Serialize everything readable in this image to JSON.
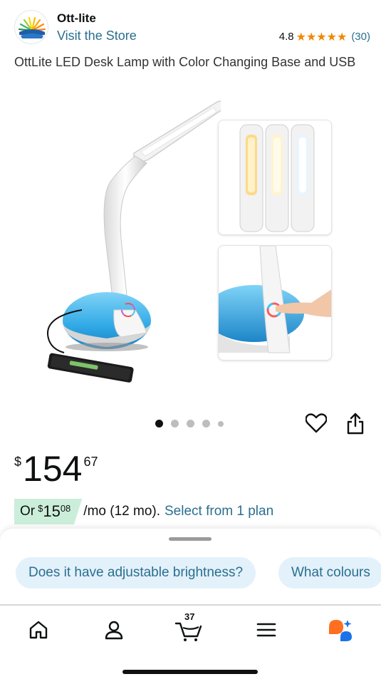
{
  "brand": {
    "name": "Ott-lite",
    "visit_store": "Visit the Store",
    "rating": "4.8",
    "stars": "★★★★★",
    "rating_count": "(30)"
  },
  "product": {
    "title": "OttLite LED Desk Lamp with Color Changing Base and USB",
    "image_count": 5,
    "active_image": 1
  },
  "price": {
    "symbol": "$",
    "whole": "154",
    "fraction": "67"
  },
  "monthly": {
    "prefix": "Or",
    "symbol": "$",
    "whole": "15",
    "fraction": "08",
    "per": "/mo (12 mo).",
    "plan_link": "Select from 1 plan"
  },
  "chips": [
    "Does it have adjustable brightness?",
    "What colours"
  ],
  "tabbar": {
    "cart_count": "37",
    "items": [
      "home-icon",
      "account-icon",
      "cart-icon",
      "menu-icon",
      "rufus-icon"
    ]
  },
  "colors": {
    "link": "#2a6f8f",
    "star": "#f08804",
    "monthly_badge": "#cbeeda",
    "chip_bg": "#e3f1fa",
    "rufus_orange": "#ff6f1f",
    "rufus_blue": "#1a73e8"
  }
}
